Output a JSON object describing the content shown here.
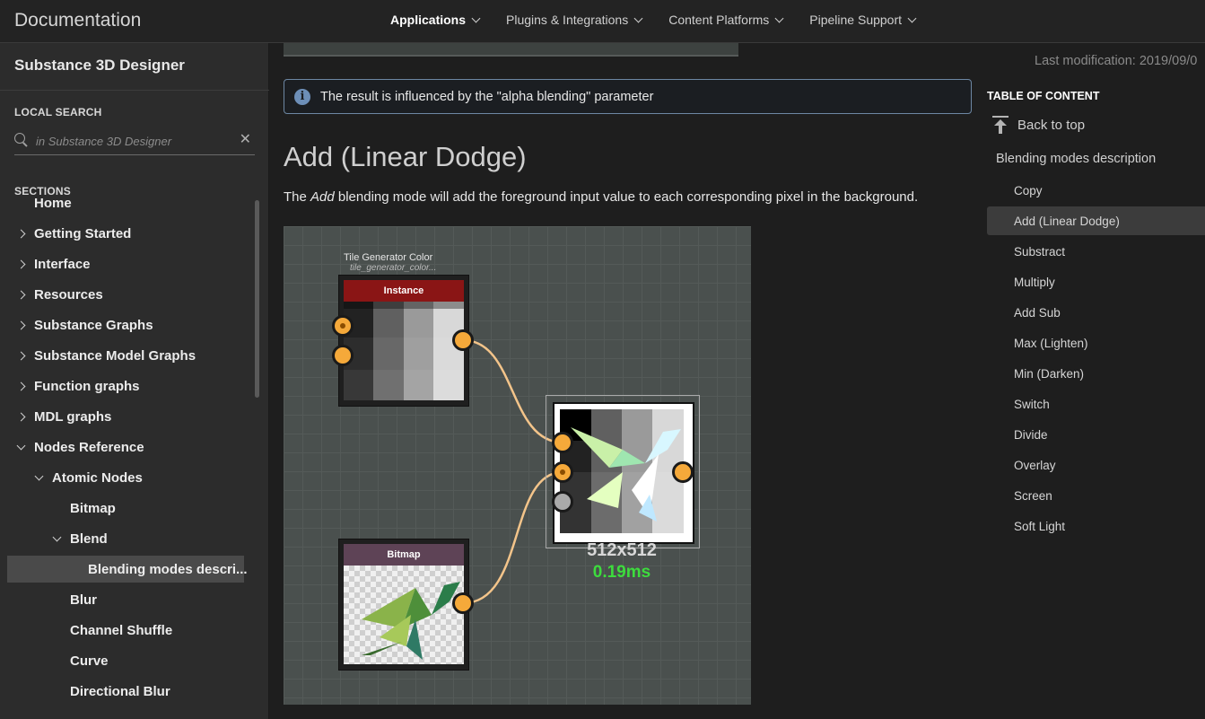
{
  "header": {
    "brand": "Documentation",
    "nav": [
      {
        "label": "Applications"
      },
      {
        "label": "Plugins & Integrations"
      },
      {
        "label": "Content Platforms"
      },
      {
        "label": "Pipeline Support"
      }
    ]
  },
  "sidebar": {
    "product_title": "Substance 3D Designer",
    "local_search_label": "LOCAL SEARCH",
    "search_placeholder": "in Substance 3D Designer",
    "sections_label": "SECTIONS",
    "items": [
      {
        "label": "Home",
        "state": "none"
      },
      {
        "label": "Getting Started",
        "state": "collapsed"
      },
      {
        "label": "Interface",
        "state": "collapsed"
      },
      {
        "label": "Resources",
        "state": "collapsed"
      },
      {
        "label": "Substance Graphs",
        "state": "collapsed"
      },
      {
        "label": "Substance Model Graphs",
        "state": "collapsed"
      },
      {
        "label": "Function graphs",
        "state": "collapsed"
      },
      {
        "label": "MDL graphs",
        "state": "collapsed"
      },
      {
        "label": "Nodes Reference",
        "state": "expanded"
      },
      {
        "label": "Atomic Nodes",
        "state": "expanded"
      },
      {
        "label": "Bitmap",
        "state": "none"
      },
      {
        "label": "Blend",
        "state": "expanded"
      },
      {
        "label": "Blending modes descri...",
        "state": "active"
      },
      {
        "label": "Blur",
        "state": "none"
      },
      {
        "label": "Channel Shuffle",
        "state": "none"
      },
      {
        "label": "Curve",
        "state": "none"
      },
      {
        "label": "Directional Blur",
        "state": "none"
      }
    ]
  },
  "main": {
    "notice": "The result is influenced by the \"alpha blending\" parameter",
    "section_title": "Add (Linear Dodge)",
    "body_before": "The ",
    "body_em": "Add",
    "body_after": " blending mode will add the foreground input value to each corresponding pixel in the background.",
    "graph": {
      "node1_caption": "Tile Generator Color",
      "node1_sub": "tile_generator_color...",
      "node1_header": "Instance",
      "node2_header": "Bitmap",
      "output_resolution": "512x512",
      "output_time": "0.19ms",
      "colors": {
        "pin": "#f5a93a",
        "instance_header": "#8a1515",
        "bitmap_header": "#5e4356",
        "time_text": "#3ddc3d",
        "link": "#f3c48a"
      }
    }
  },
  "toc": {
    "last_modification": "Last modification: 2019/09/0",
    "title": "TABLE OF CONTENT",
    "back_to_top": "Back to top",
    "parent": "Blending modes description",
    "items": [
      {
        "label": "Copy"
      },
      {
        "label": "Add (Linear Dodge)",
        "active": true
      },
      {
        "label": "Substract"
      },
      {
        "label": "Multiply"
      },
      {
        "label": "Add Sub"
      },
      {
        "label": "Max (Lighten)"
      },
      {
        "label": "Min (Darken)"
      },
      {
        "label": "Switch"
      },
      {
        "label": "Divide"
      },
      {
        "label": "Overlay"
      },
      {
        "label": "Screen"
      },
      {
        "label": "Soft Light"
      }
    ]
  }
}
